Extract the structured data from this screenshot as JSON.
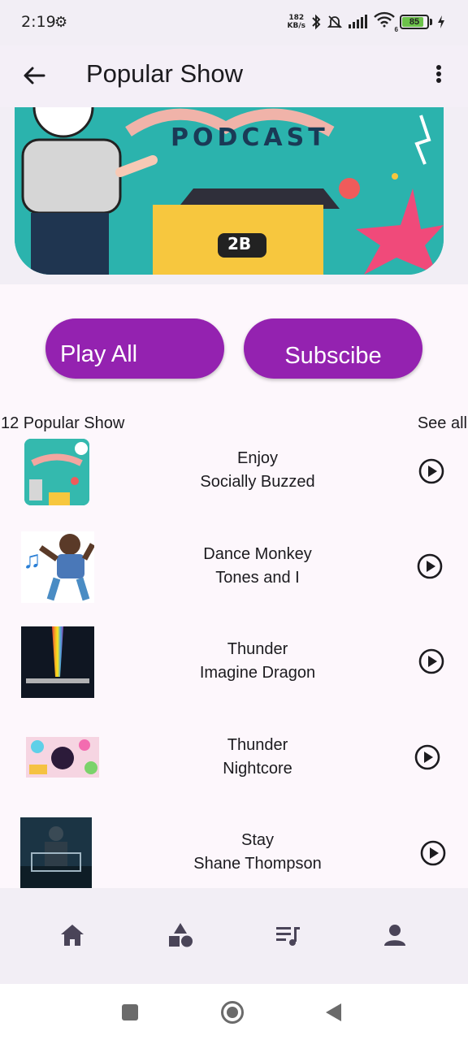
{
  "status_bar": {
    "time": "2:19",
    "net_speed_value": "182",
    "net_speed_unit": "KB/s",
    "wifi_sub": "6",
    "battery_level": "85"
  },
  "app_bar": {
    "title": "Popular Show",
    "back_icon": "arrow-back-icon",
    "menu_icon": "more-vert-icon"
  },
  "hero": {
    "image_text": "PODCAST",
    "badge_text": "2B"
  },
  "actions": {
    "play_all": "Play All",
    "subscribe": "Subscibe"
  },
  "section": {
    "title": "12 Popular Show",
    "see_all": "See all"
  },
  "tracks": [
    {
      "title": "Enjoy",
      "artist": "Socially Buzzed"
    },
    {
      "title": "Dance Monkey",
      "artist": "Tones and I"
    },
    {
      "title": "Thunder",
      "artist": "Imagine Dragon"
    },
    {
      "title": "Thunder",
      "artist": "Nightcore"
    },
    {
      "title": "Stay",
      "artist": "Shane Thompson"
    }
  ],
  "bottom_nav": {
    "items": [
      "home-icon",
      "category-icon",
      "queue-music-icon",
      "person-icon"
    ]
  },
  "colors": {
    "accent": "#9422b0",
    "background": "#fdf7fc",
    "bar": "#f2eef5"
  }
}
